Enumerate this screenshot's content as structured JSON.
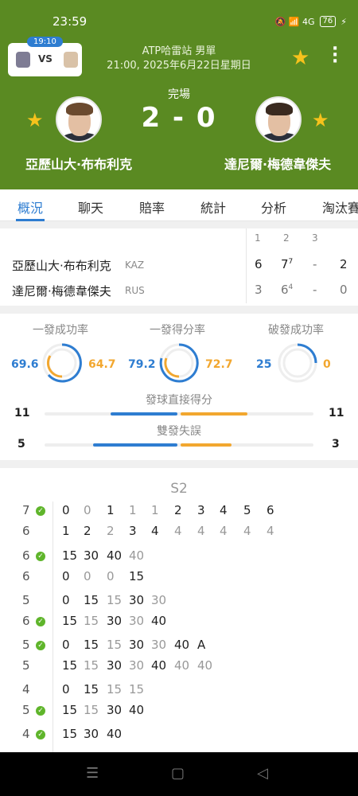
{
  "status_bar": {
    "time": "23:59",
    "icons": "🔕 📶 4G",
    "battery": "76"
  },
  "mini_match": {
    "time": "19:10",
    "vs": "VS"
  },
  "match": {
    "tournament": "ATP哈雷站 男單",
    "datetime": "21:00, 2025年6月22日星期日",
    "status": "完場",
    "score": "2 - 0",
    "player1": "亞歷山大·布布利克",
    "player2": "達尼爾·梅德韋傑夫"
  },
  "tabs": [
    "概況",
    "聊天",
    "賠率",
    "統計",
    "分析",
    "淘汰賽"
  ],
  "sets": {
    "headers": [
      "1",
      "2",
      "3"
    ],
    "rows": [
      {
        "name": "亞歷山大·布布利克",
        "cc": "KAZ",
        "s1": "6",
        "s2": "7",
        "s2_tb": "7",
        "s3": "-",
        "total": "2"
      },
      {
        "name": "達尼爾·梅德韋傑夫",
        "cc": "RUS",
        "s1": "3",
        "s2": "6",
        "s2_tb": "4",
        "s3": "-",
        "total": "0"
      }
    ]
  },
  "stats": {
    "first_serve_pct": {
      "label": "一發成功率",
      "p1": "69.6",
      "p2": "64.7"
    },
    "first_serve_pts": {
      "label": "一發得分率",
      "p1": "79.2",
      "p2": "72.7"
    },
    "break_pts": {
      "label": "破發成功率",
      "p1": "25",
      "p2": "0"
    },
    "aces": {
      "label": "發球直接得分",
      "p1": "11",
      "p2": "11"
    },
    "double_faults": {
      "label": "雙發失誤",
      "p1": "5",
      "p2": "3"
    }
  },
  "pbp": {
    "title": "S2",
    "games": [
      {
        "top_score": "7",
        "bottom_score": "6",
        "top_check": true,
        "bottom_check": false,
        "top_pts": [
          "0",
          "0",
          "1",
          "1",
          "1",
          "2",
          "3",
          "4",
          "5",
          "6"
        ],
        "bottom_pts": [
          "1",
          "2",
          "2",
          "3",
          "4",
          "4",
          "4",
          "4",
          "4",
          "4"
        ]
      },
      {
        "top_score": "6",
        "bottom_score": "6",
        "top_check": true,
        "bottom_check": false,
        "top_pts": [
          "15",
          "30",
          "40",
          "40"
        ],
        "bottom_pts": [
          "0",
          "0",
          "0",
          "15"
        ]
      },
      {
        "top_score": "5",
        "bottom_score": "6",
        "top_check": false,
        "bottom_check": true,
        "top_pts": [
          "0",
          "15",
          "15",
          "30",
          "30"
        ],
        "bottom_pts": [
          "15",
          "15",
          "30",
          "30",
          "40"
        ]
      },
      {
        "top_score": "5",
        "bottom_score": "5",
        "top_check": true,
        "bottom_check": false,
        "top_pts": [
          "0",
          "15",
          "15",
          "30",
          "30",
          "40",
          "A"
        ],
        "bottom_pts": [
          "15",
          "15",
          "30",
          "30",
          "40",
          "40",
          "40"
        ]
      },
      {
        "top_score": "4",
        "bottom_score": "5",
        "top_check": false,
        "bottom_check": true,
        "top_pts": [
          "0",
          "15",
          "15",
          "15"
        ],
        "bottom_pts": [
          "15",
          "15",
          "30",
          "40"
        ]
      },
      {
        "top_score": "4",
        "top_check": true,
        "top_pts": [
          "15",
          "30",
          "40"
        ]
      }
    ]
  },
  "colors": {
    "header_green": "#5a8a22",
    "accent_blue": "#2e7dd1",
    "accent_orange": "#f2a72f",
    "star": "#f6c21c"
  }
}
